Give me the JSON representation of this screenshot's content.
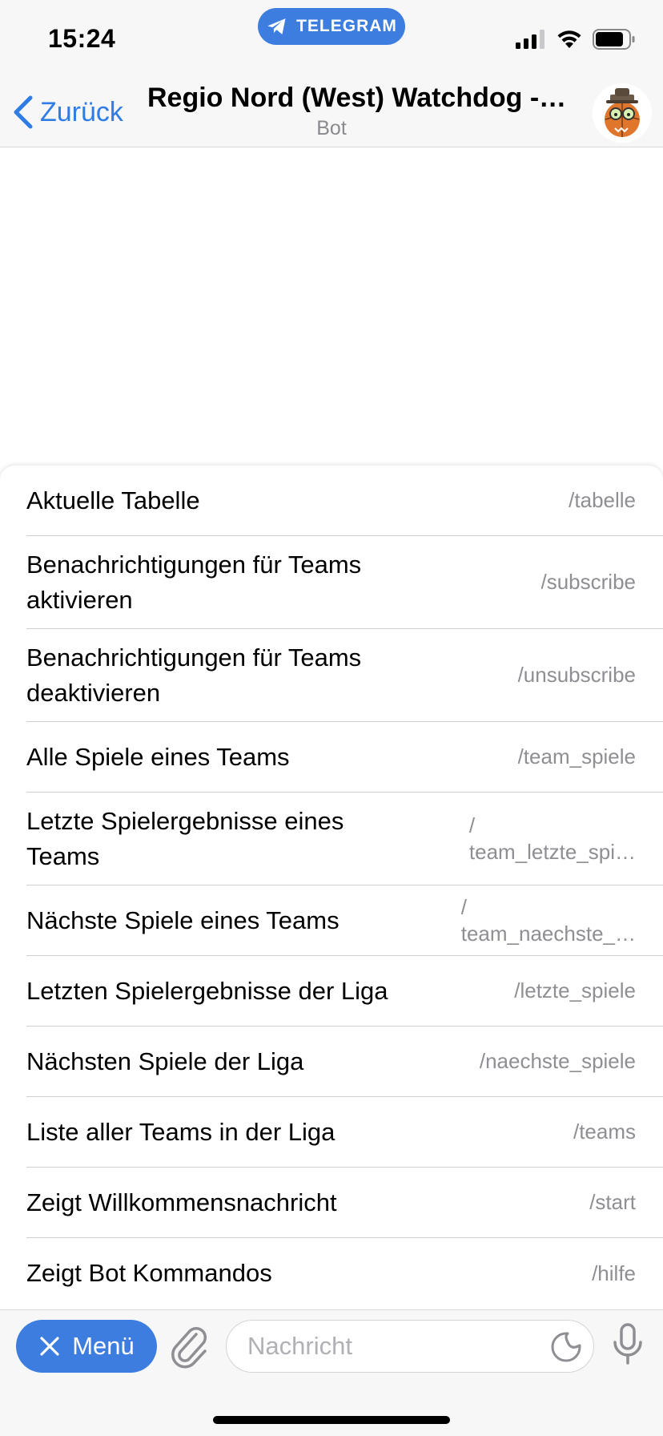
{
  "status_bar": {
    "time": "15:24",
    "pill_label": "TELEGRAM"
  },
  "header": {
    "back_label": "Zurück",
    "title": "Regio Nord (West) Watchdog -…",
    "subtitle": "Bot"
  },
  "commands": [
    {
      "description": "Aktuelle Tabelle",
      "command": "/tabelle"
    },
    {
      "description": "Benachrichtigungen für Teams aktivieren",
      "command": "/subscribe"
    },
    {
      "description": "Benachrichtigungen für Teams deaktivieren",
      "command": "/unsubscribe"
    },
    {
      "description": "Alle Spiele eines Teams",
      "command": "/team_spiele"
    },
    {
      "description": "Letzte Spielergebnisse eines Teams",
      "command_line1": "/",
      "command_line2": "team_letzte_spi…"
    },
    {
      "description": "Nächste Spiele eines Teams",
      "command_line1": "/",
      "command_line2": "team_naechste_…"
    },
    {
      "description": "Letzten Spielergebnisse der Liga",
      "command": "/letzte_spiele"
    },
    {
      "description": "Nächsten Spiele der Liga",
      "command": "/naechste_spiele"
    },
    {
      "description": "Liste aller Teams in der Liga",
      "command": "/teams"
    },
    {
      "description": "Zeigt Willkommensnachricht",
      "command": "/start"
    },
    {
      "description": "Zeigt Bot Kommandos",
      "command": "/hilfe"
    }
  ],
  "input_bar": {
    "menu_label": "Menü",
    "message_placeholder": "Nachricht"
  },
  "colors": {
    "accent": "#3d7de0",
    "link": "#2f7ce4",
    "secondary_text": "#8e8e93"
  },
  "icons": {
    "back": "chevron-left-icon",
    "telegram": "paper-plane-icon",
    "menu_close": "close-icon",
    "attach": "paperclip-icon",
    "sticker": "sticker-icon",
    "mic": "microphone-icon"
  }
}
